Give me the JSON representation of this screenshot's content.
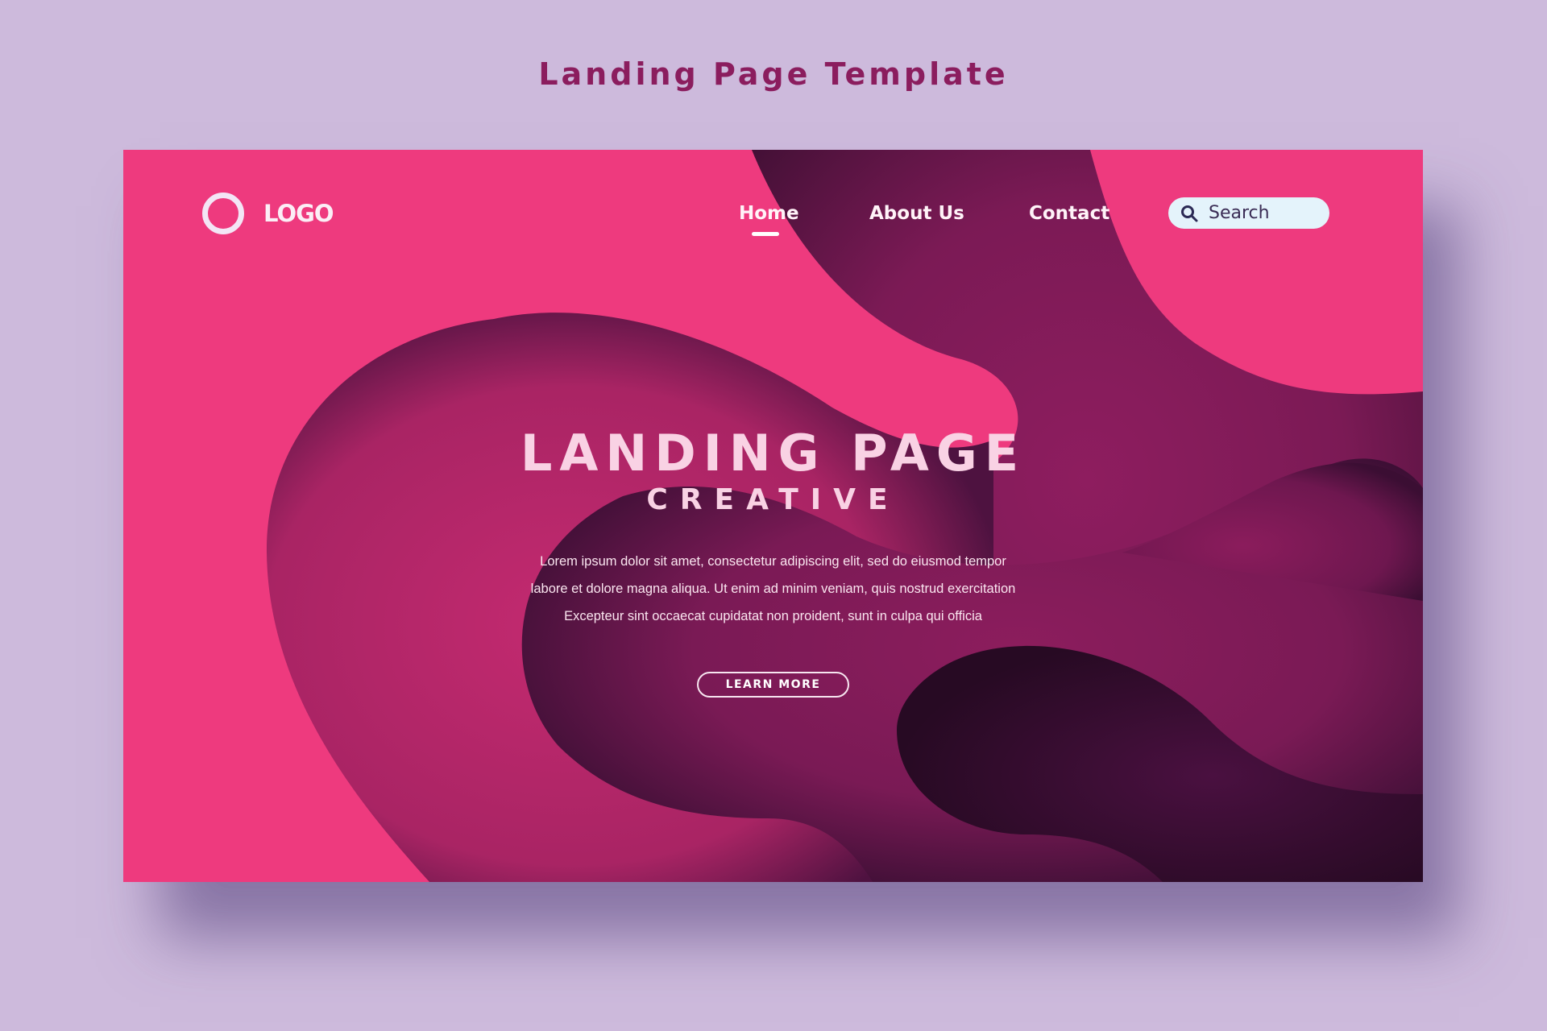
{
  "page_title": "Landing Page Template",
  "colors": {
    "background": "#cdbadc",
    "title": "#8b1d5e",
    "hero_base": "#ee3a7e",
    "wave_dark": "#3d0f35",
    "wave_mid": "#7a1a56",
    "search_bg": "#e4f3fb"
  },
  "header": {
    "logo": {
      "icon": "ring-logo-icon",
      "text": "LOGO"
    },
    "nav": {
      "home": "Home",
      "about": "About Us",
      "contact": "Contact",
      "active": "Home"
    },
    "search": {
      "icon": "search-icon",
      "placeholder": "Search"
    }
  },
  "hero": {
    "heading": "LANDING PAGE",
    "subheading": "CREATIVE",
    "body_lines": [
      "Lorem ipsum dolor sit amet, consectetur adipiscing elit, sed do eiusmod tempor",
      "labore et dolore magna aliqua. Ut enim ad minim veniam, quis nostrud exercitation",
      "Excepteur sint occaecat cupidatat non proident, sunt in culpa qui officia"
    ],
    "cta_label": "LEARN MORE"
  }
}
